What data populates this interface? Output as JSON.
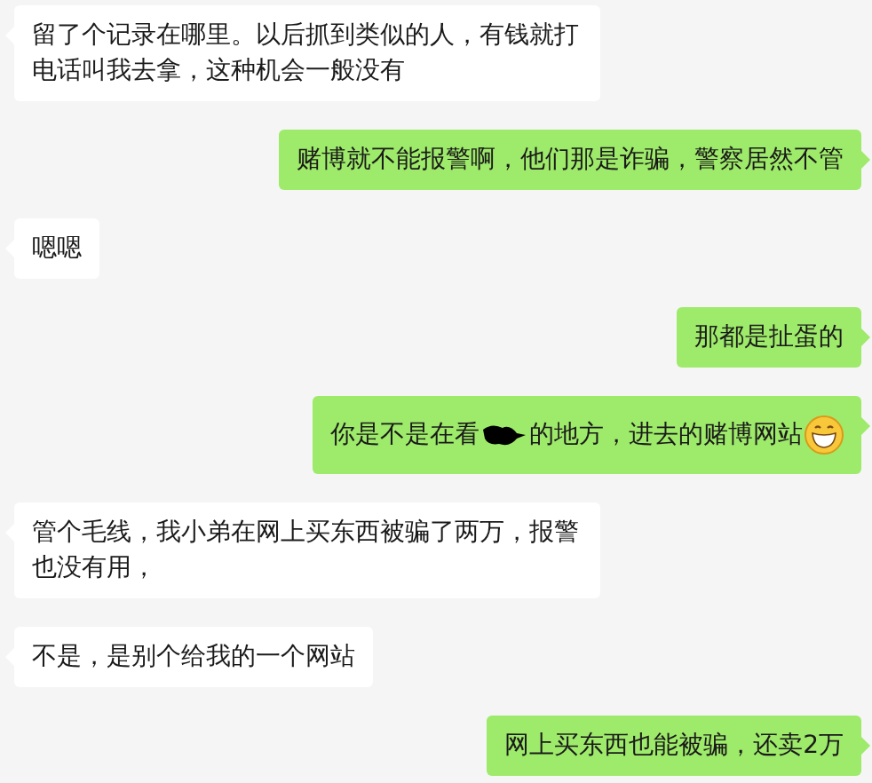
{
  "messages": [
    {
      "kind": "left",
      "text": "留了个记录在哪里。以后抓到类似的人，有钱就打电话叫我去拿，这种机会一般没有"
    },
    {
      "kind": "right",
      "text": "赌博就不能报警啊，他们那是诈骗，警察居然不管"
    },
    {
      "kind": "left",
      "text": "嗯嗯"
    },
    {
      "kind": "right",
      "text": "那都是扯蛋的"
    },
    {
      "kind": "right",
      "text": "你是不是在看",
      "redacted": true,
      "text_after": "的地方，进去的赌博网站",
      "emoji": true
    },
    {
      "kind": "left",
      "text": "管个毛线，我小弟在网上买东西被骗了两万，报警也没有用，"
    },
    {
      "kind": "left",
      "text": "不是，是别个给我的一个网站"
    },
    {
      "kind": "right",
      "text": "网上买东西也能被骗，还卖2万"
    }
  ]
}
